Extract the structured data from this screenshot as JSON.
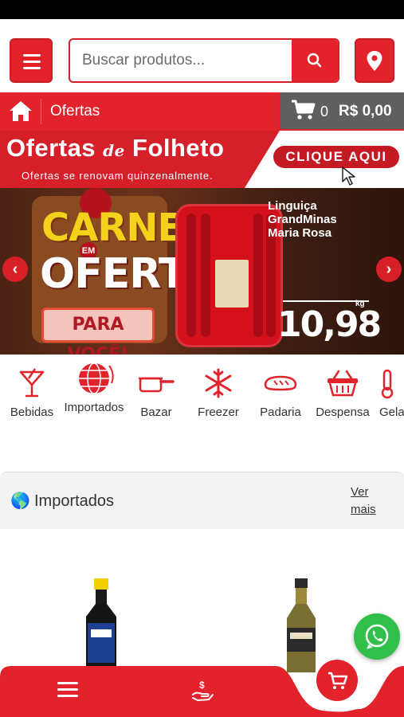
{
  "search": {
    "placeholder": "Buscar produtos..."
  },
  "nav": {
    "breadcrumb": "Ofertas"
  },
  "cart": {
    "count": "0",
    "total": "R$ 0,00"
  },
  "promo": {
    "title_part1": "Ofertas",
    "title_de": "de",
    "title_part2": "Folheto",
    "subtitle": "Ofertas se renovam quinzenalmente.",
    "cta": "CLIQUE AQUI"
  },
  "banner": {
    "line1": "CARNES",
    "em": "EM",
    "line2": "OFERTA",
    "line3": "PARA VOCÊ!",
    "product_name": [
      "Linguiça",
      "GrandMinas",
      "Maria Rosa"
    ],
    "price_unit": "kg",
    "price": "10,98"
  },
  "categories": [
    {
      "label": "Bebidas",
      "icon": "cocktail-glass-icon"
    },
    {
      "label": "Importados",
      "icon": "globe-icon"
    },
    {
      "label": "Bazar",
      "icon": "saucepan-icon"
    },
    {
      "label": "Freezer",
      "icon": "snowflake-icon"
    },
    {
      "label": "Padaria",
      "icon": "bread-icon"
    },
    {
      "label": "Despensa",
      "icon": "basket-icon"
    },
    {
      "label": "Gela",
      "icon": "thermometer-icon"
    }
  ],
  "section": {
    "title": "Importados",
    "more_line1": "Ver",
    "more_line2": "mais"
  },
  "colors": {
    "brand_red": "#e3232c",
    "whatsapp_green": "#2fbf4a",
    "cart_box_gray": "#5f5f5f"
  }
}
